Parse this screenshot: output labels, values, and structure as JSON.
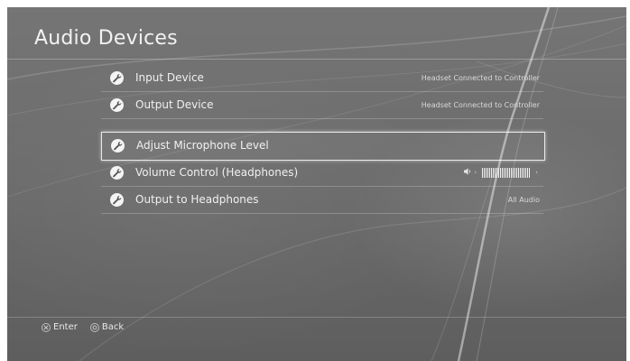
{
  "page": {
    "title": "Audio Devices"
  },
  "menu": {
    "items": [
      {
        "label": "Input Device",
        "value": "Headset Connected to Controller"
      },
      {
        "label": "Output Device",
        "value": "Headset Connected to Controller"
      },
      {
        "label": "Adjust Microphone Level",
        "value": ""
      },
      {
        "label": "Volume Control (Headphones)",
        "volume_level": 0.9
      },
      {
        "label": "Output to Headphones",
        "value": "All Audio"
      }
    ],
    "selected_index": 2
  },
  "footer": {
    "enter_label": "Enter",
    "back_label": "Back"
  },
  "colors": {
    "background": "#6c6c6c",
    "text": "#f0f0f0",
    "highlight": "#ffffff"
  },
  "icons": {
    "item_icon": "wrench-icon",
    "enter_icon": "cross-button-icon",
    "back_icon": "circle-button-icon"
  }
}
